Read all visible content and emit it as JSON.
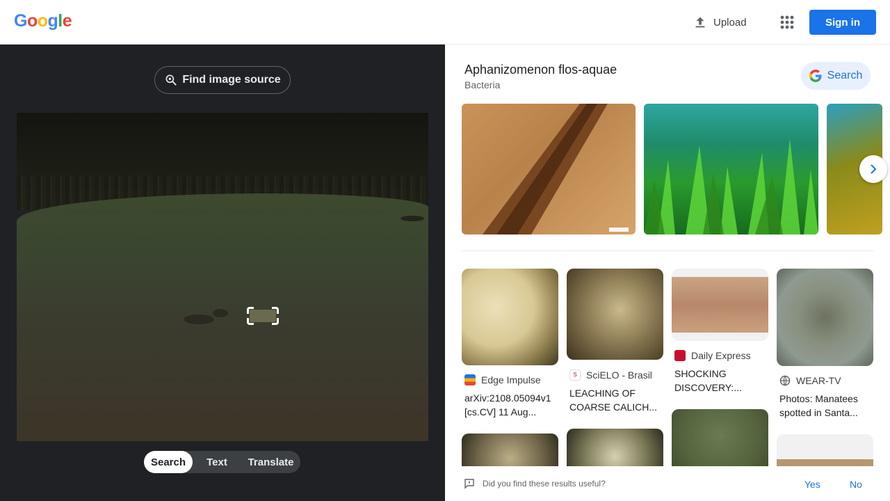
{
  "header": {
    "logo": [
      "G",
      "o",
      "o",
      "g",
      "l",
      "e"
    ],
    "logo_colors": [
      "#4285F4",
      "#EA4335",
      "#FBBC05",
      "#4285F4",
      "#34A853",
      "#EA4335"
    ],
    "upload_label": "Upload",
    "signin_label": "Sign in"
  },
  "left": {
    "find_source_label": "Find image source",
    "modes": [
      {
        "label": "Search",
        "active": true
      },
      {
        "label": "Text",
        "active": false
      },
      {
        "label": "Translate",
        "active": false
      }
    ]
  },
  "knowledge": {
    "title": "Aphanizomenon flos-aquae",
    "subtitle": "Bacteria",
    "search_label": "Search"
  },
  "results": [
    {
      "source": "Edge Impulse",
      "desc": "arXiv:2108.05094v1 [cs.CV] 11 Aug..."
    },
    {
      "source": "SciELO - Brasil",
      "desc": "LEACHING OF COARSE CALICH..."
    },
    {
      "source": "Daily Express",
      "desc": "SHOCKING DISCOVERY:..."
    },
    {
      "source": "WEAR-TV",
      "desc": "Photos: Manatees spotted in Santa..."
    }
  ],
  "feedback": {
    "question": "Did you find these results useful?",
    "yes": "Yes",
    "no": "No"
  },
  "colors": {
    "accent": "#1a73e8",
    "dark_panel": "#202124"
  }
}
